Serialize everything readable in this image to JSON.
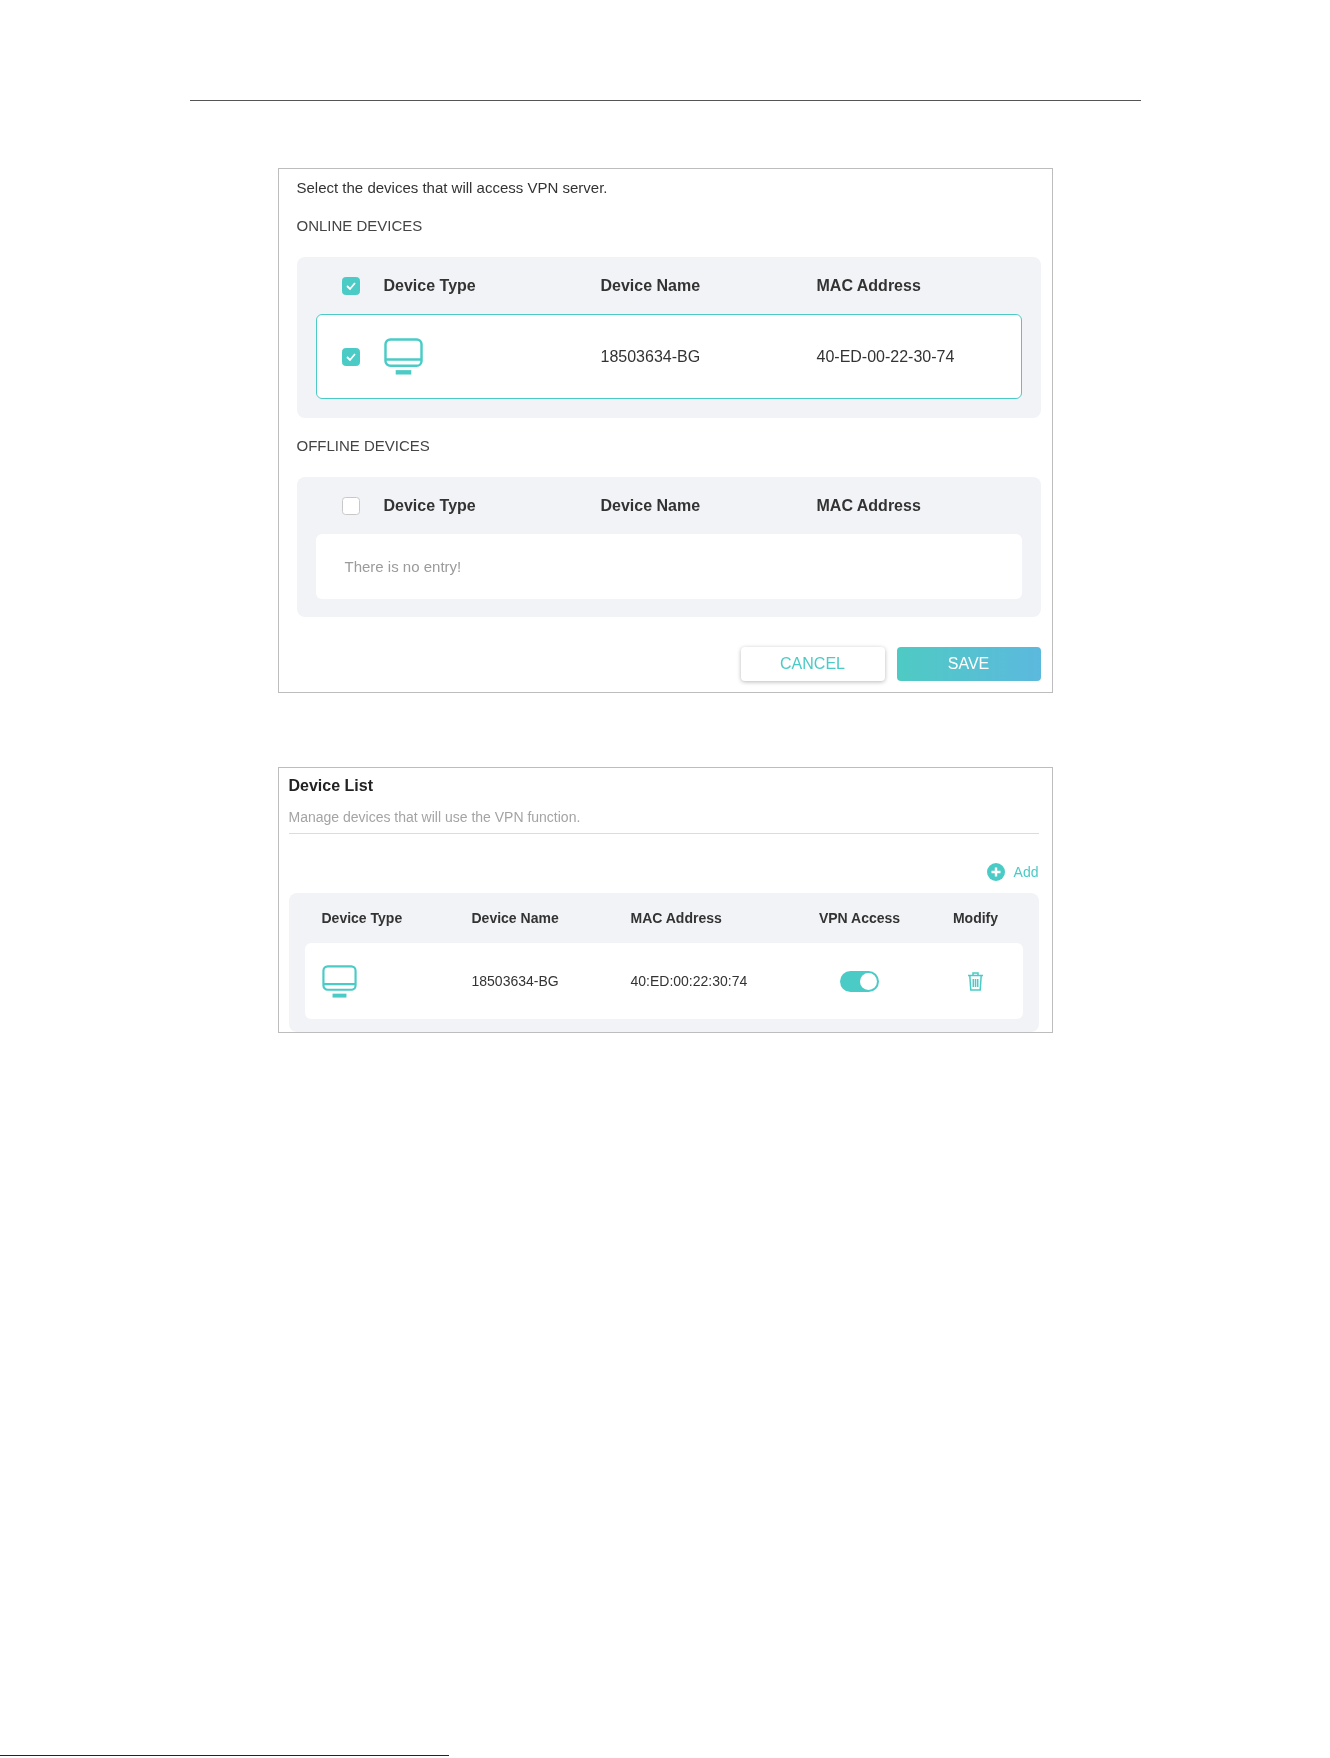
{
  "device_selection": {
    "instruction": "Select the devices that will access VPN server.",
    "sections": [
      {
        "title": "ONLINE DEVICES",
        "select_all_checked": true,
        "columns": [
          "Device Type",
          "Device Name",
          "MAC Address"
        ],
        "rows": [
          {
            "checked": true,
            "device_name": "18503634-BG",
            "mac_address": "40-ED-00-22-30-74"
          }
        ]
      },
      {
        "title": "OFFLINE DEVICES",
        "select_all_checked": false,
        "columns": [
          "Device Type",
          "Device Name",
          "MAC Address"
        ],
        "empty_message": "There is no entry!"
      }
    ],
    "buttons": [
      {
        "label": "CANCEL",
        "kind": "secondary"
      },
      {
        "label": "SAVE",
        "kind": "primary"
      }
    ]
  },
  "device_list": {
    "title": "Device List",
    "subtitle": "Manage devices that will use the VPN function.",
    "add_button": "Add",
    "columns": [
      "Device Type",
      "Device Name",
      "MAC Address",
      "VPN Access",
      "Modify"
    ],
    "rows": [
      {
        "device_name": "18503634-BG",
        "mac_address": "40:ED:00:22:30:74",
        "vpn_access": true
      }
    ]
  }
}
